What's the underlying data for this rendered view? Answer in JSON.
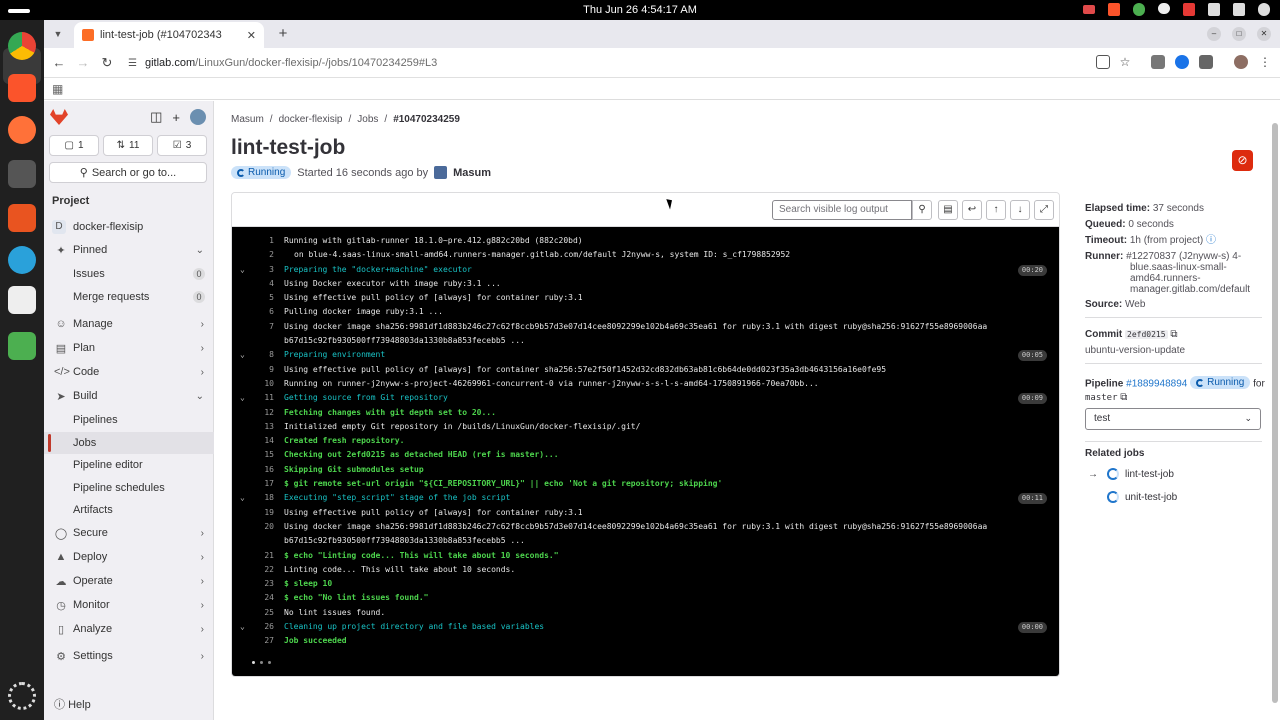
{
  "system": {
    "clock": "Thu Jun 26     4:54:17 AM"
  },
  "browser": {
    "tab_title": "lint-test-job (#104702343",
    "url_host": "gitlab.com",
    "url_path": "/LinuxGun/docker-flexisip/-/jobs/10470234259#L3"
  },
  "sidebar": {
    "counters": [
      {
        "icon": "issues-icon",
        "value": "1"
      },
      {
        "icon": "merge-request-icon",
        "value": "11"
      },
      {
        "icon": "todo-icon",
        "value": "3"
      }
    ],
    "search_label": "Search or go to...",
    "section_label": "Project",
    "project_name": "docker-flexisip",
    "project_initial": "D",
    "items": [
      {
        "label": "Pinned"
      },
      {
        "label": "Issues",
        "badge": "0"
      },
      {
        "label": "Merge requests",
        "badge": "0"
      },
      {
        "label": "Manage"
      },
      {
        "label": "Plan"
      },
      {
        "label": "Code"
      },
      {
        "label": "Build"
      },
      {
        "label": "Pipelines"
      },
      {
        "label": "Jobs"
      },
      {
        "label": "Pipeline editor"
      },
      {
        "label": "Pipeline schedules"
      },
      {
        "label": "Artifacts"
      },
      {
        "label": "Secure"
      },
      {
        "label": "Deploy"
      },
      {
        "label": "Operate"
      },
      {
        "label": "Monitor"
      },
      {
        "label": "Analyze"
      },
      {
        "label": "Settings"
      }
    ],
    "help_label": "Help"
  },
  "breadcrumb": [
    "Masum",
    "docker-flexisip",
    "Jobs",
    "#10470234259"
  ],
  "job": {
    "title": "lint-test-job",
    "status": "Running",
    "started": "Started 16 seconds ago by",
    "user": "Masum"
  },
  "log_toolbar": {
    "search_placeholder": "Search visible log output"
  },
  "log": [
    {
      "n": "1",
      "text": "Running with gitlab-runner 18.1.0~pre.412.g882c20bd (882c20bd)",
      "kind": "plain"
    },
    {
      "n": "2",
      "text": "on blue-4.saas-linux-small-amd64.runners-manager.gitlab.com/default J2nyww-s, system ID: s_cf1798852952",
      "kind": "plain",
      "indent": true
    },
    {
      "n": "3",
      "text": "Preparing the \"docker+machine\" executor",
      "kind": "sec",
      "dur": "00:20"
    },
    {
      "n": "4",
      "text": "Using Docker executor with image ruby:3.1 ...",
      "kind": "plain"
    },
    {
      "n": "5",
      "text": "Using effective pull policy of [always] for container ruby:3.1",
      "kind": "plain"
    },
    {
      "n": "6",
      "text": "Pulling docker image ruby:3.1 ...",
      "kind": "plain"
    },
    {
      "n": "7",
      "text": "Using docker image sha256:9981df1d883b246c27c62f8ccb9b57d3e07d14cee8092299e102b4a69c35ea61 for ruby:3.1 with digest ruby@sha256:91627f55e8969006aa",
      "kind": "plain"
    },
    {
      "n": "",
      "text": "b67d15c92fb930500ff73948803da1330b8a853fecebb5 ...",
      "kind": "plain"
    },
    {
      "n": "8",
      "text": "Preparing environment",
      "kind": "sec",
      "dur": "00:05"
    },
    {
      "n": "9",
      "text": "Using effective pull policy of [always] for container sha256:57e2f50f1452d32cd832db63ab81c6b64de0dd023f35a3db4643156a16e0fe95",
      "kind": "plain"
    },
    {
      "n": "10",
      "text": "Running on runner-j2nyww-s-project-46269961-concurrent-0 via runner-j2nyww-s-s-l-s-amd64-1750891966-70ea70bb...",
      "kind": "plain"
    },
    {
      "n": "11",
      "text": "Getting source from Git repository",
      "kind": "sec",
      "dur": "00:09"
    },
    {
      "n": "12",
      "text": "Fetching changes with git depth set to 20...",
      "kind": "cmd"
    },
    {
      "n": "13",
      "text": "Initialized empty Git repository in /builds/LinuxGun/docker-flexisip/.git/",
      "kind": "plain"
    },
    {
      "n": "14",
      "text": "Created fresh repository.",
      "kind": "cmd"
    },
    {
      "n": "15",
      "text": "Checking out 2efd0215 as detached HEAD (ref is master)...",
      "kind": "cmd"
    },
    {
      "n": "16",
      "text": "Skipping Git submodules setup",
      "kind": "cmd"
    },
    {
      "n": "17",
      "text": "$ git remote set-url origin \"${CI_REPOSITORY_URL}\" || echo 'Not a git repository; skipping'",
      "kind": "cmd"
    },
    {
      "n": "18",
      "text": "Executing \"step_script\" stage of the job script",
      "kind": "sec",
      "dur": "00:11"
    },
    {
      "n": "19",
      "text": "Using effective pull policy of [always] for container ruby:3.1",
      "kind": "plain"
    },
    {
      "n": "20",
      "text": "Using docker image sha256:9981df1d883b246c27c62f8ccb9b57d3e07d14cee8092299e102b4a69c35ea61 for ruby:3.1 with digest ruby@sha256:91627f55e8969006aa",
      "kind": "plain"
    },
    {
      "n": "",
      "text": "b67d15c92fb930500ff73948803da1330b8a853fecebb5 ...",
      "kind": "plain"
    },
    {
      "n": "21",
      "text": "$ echo \"Linting code... This will take about 10 seconds.\"",
      "kind": "cmd"
    },
    {
      "n": "22",
      "text": "Linting code... This will take about 10 seconds.",
      "kind": "plain"
    },
    {
      "n": "23",
      "text": "$ sleep 10",
      "kind": "cmd"
    },
    {
      "n": "24",
      "text": "$ echo \"No lint issues found.\"",
      "kind": "cmd"
    },
    {
      "n": "25",
      "text": "No lint issues found.",
      "kind": "plain"
    },
    {
      "n": "26",
      "text": "Cleaning up project directory and file based variables",
      "kind": "sec",
      "dur": "00:00"
    },
    {
      "n": "27",
      "text": "Job succeeded",
      "kind": "cmd"
    }
  ],
  "details": {
    "elapsed_label": "Elapsed time:",
    "elapsed": "37 seconds",
    "queued_label": "Queued:",
    "queued": "0 seconds",
    "timeout_label": "Timeout:",
    "timeout": "1h (from project)",
    "runner_label": "Runner:",
    "runner_l1": "#12270837 (J2nyww-s) 4-",
    "runner_l2": "blue.saas-linux-small-",
    "runner_l3": "amd64.runners-",
    "runner_l4": "manager.gitlab.com/default",
    "source_label": "Source:",
    "source": "Web",
    "commit_label": "Commit",
    "commit_sha": "2efd0215",
    "commit_msg": "ubuntu-version-update",
    "pipeline_label": "Pipeline",
    "pipeline_id": "#1889948894",
    "pipeline_status": "Running",
    "pipeline_for": "for",
    "branch": "master",
    "stage": "test",
    "related_label": "Related jobs",
    "related": [
      {
        "name": "lint-test-job",
        "current": true
      },
      {
        "name": "unit-test-job",
        "current": false
      }
    ]
  }
}
